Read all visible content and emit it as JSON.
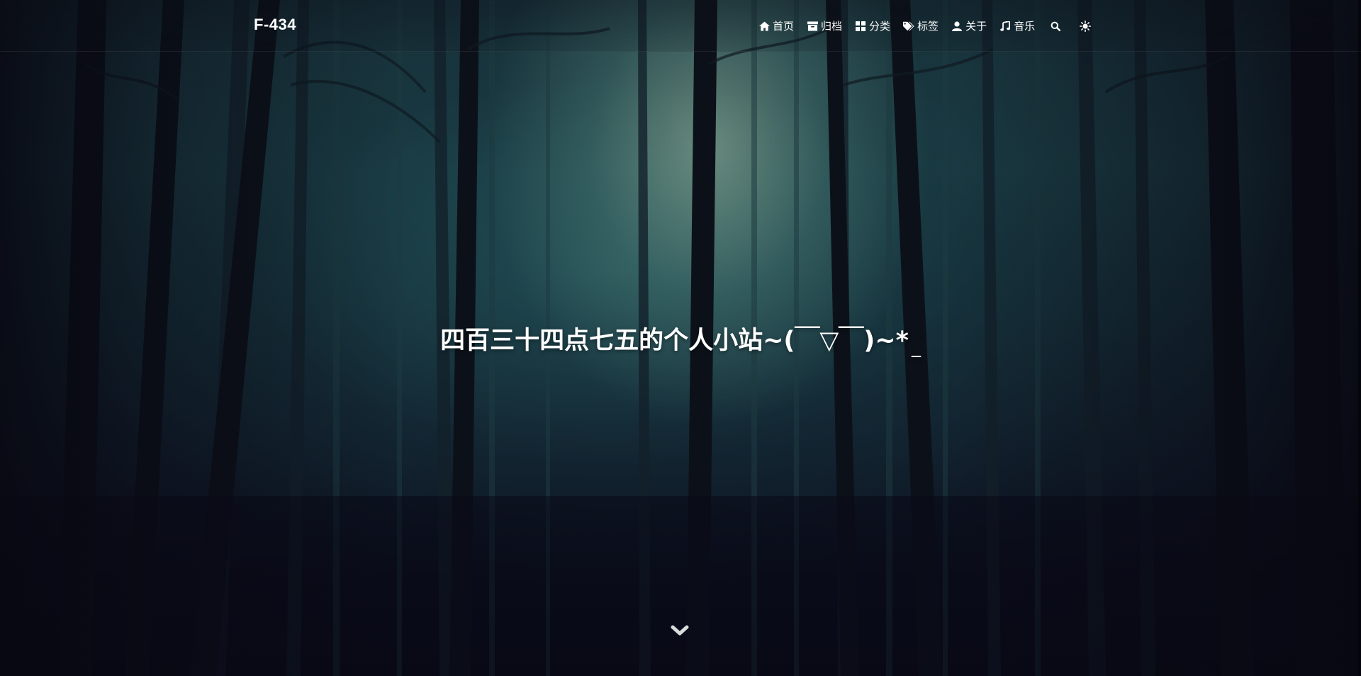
{
  "site": {
    "brand": "F-434",
    "hero_title": "四百三十四点七五的个人小站~(￣▽￣)~*",
    "cursor": "_"
  },
  "nav": {
    "items": [
      {
        "label": "首页",
        "icon": "home-icon"
      },
      {
        "label": "归档",
        "icon": "archive-icon"
      },
      {
        "label": "分类",
        "icon": "grid-icon"
      },
      {
        "label": "标签",
        "icon": "tags-icon"
      },
      {
        "label": "关于",
        "icon": "user-icon"
      },
      {
        "label": "音乐",
        "icon": "music-icon"
      }
    ],
    "search_icon": "search-icon",
    "theme_toggle_icon": "sun-icon"
  },
  "scroll_icon": "chevron-down-icon",
  "colors": {
    "text": "#ffffff",
    "background_dark": "#0b0c16",
    "forest_teal": "#1b3c44",
    "light_glow": "#a8c8aa"
  }
}
